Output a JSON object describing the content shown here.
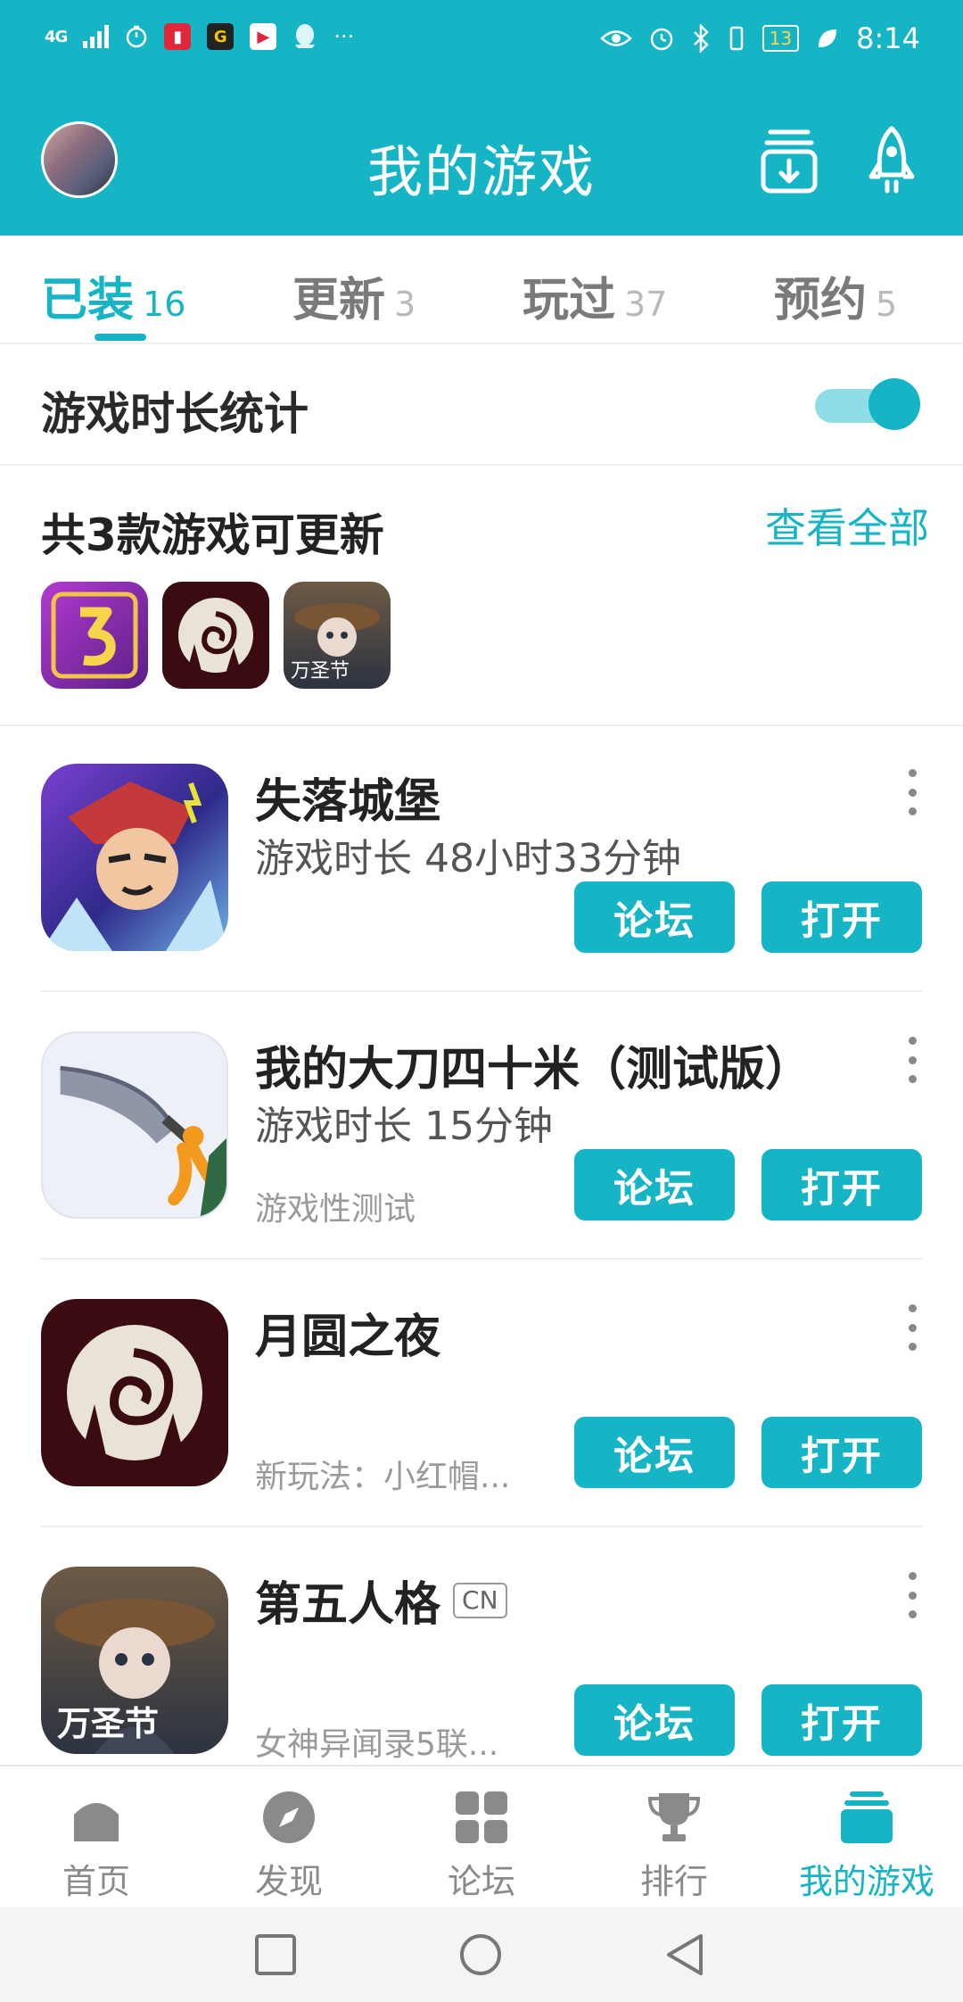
{
  "status_bar": {
    "network": "4G",
    "time": "8:14",
    "battery": "13",
    "more": "···",
    "app_icons": [
      "book-app-icon",
      "g-app-icon",
      "video-app-icon",
      "qq-app-icon"
    ],
    "right_icons": [
      "eye-icon",
      "alarm-icon",
      "bluetooth-icon",
      "vibrate-icon",
      "leaf-icon"
    ]
  },
  "header": {
    "title": "我的游戏",
    "icons": [
      "avatar",
      "download-icon",
      "rocket-icon"
    ]
  },
  "tabs": [
    {
      "label": "已装",
      "count": "16",
      "active": true
    },
    {
      "label": "更新",
      "count": "3",
      "active": false
    },
    {
      "label": "玩过",
      "count": "37",
      "active": false
    },
    {
      "label": "预约",
      "count": "5",
      "active": false
    }
  ],
  "playtime_stats": {
    "label": "游戏时长统计",
    "enabled": true
  },
  "updates": {
    "title": "共3款游戏可更新",
    "view_all": "查看全部",
    "thumbnails": [
      {
        "name": "game-3-thumbnail",
        "caption": ""
      },
      {
        "name": "moon-night-thumbnail",
        "caption": ""
      },
      {
        "name": "identity-v-thumbnail",
        "caption": "万圣节"
      }
    ]
  },
  "games": [
    {
      "name": "失落城堡",
      "badge": "",
      "playtime": "游戏时长 48小时33分钟",
      "note": "",
      "icon_caption": "",
      "forum": "论坛",
      "open": "打开"
    },
    {
      "name": "我的大刀四十米（测试版）",
      "badge": "",
      "playtime": "游戏时长 15分钟",
      "note": "游戏性测试",
      "icon_caption": "",
      "forum": "论坛",
      "open": "打开"
    },
    {
      "name": "月圆之夜",
      "badge": "",
      "playtime": "",
      "note": "新玩法：小红帽...",
      "icon_caption": "",
      "forum": "论坛",
      "open": "打开"
    },
    {
      "name": "第五人格",
      "badge": "CN",
      "playtime": "",
      "note": "女神异闻录5联...",
      "icon_caption": "万圣节",
      "forum": "论坛",
      "open": "打开"
    }
  ],
  "bottom_nav": [
    {
      "label": "首页",
      "icon": "home-icon",
      "active": false
    },
    {
      "label": "发现",
      "icon": "compass-icon",
      "active": false
    },
    {
      "label": "论坛",
      "icon": "grid-icon",
      "active": false
    },
    {
      "label": "排行",
      "icon": "trophy-icon",
      "active": false
    },
    {
      "label": "我的游戏",
      "icon": "stack-icon",
      "active": true
    }
  ],
  "system_nav": [
    "recents-button",
    "home-button",
    "back-button"
  ],
  "colors": {
    "accent": "#16b5c6",
    "accent_light": "#8fdde6"
  }
}
